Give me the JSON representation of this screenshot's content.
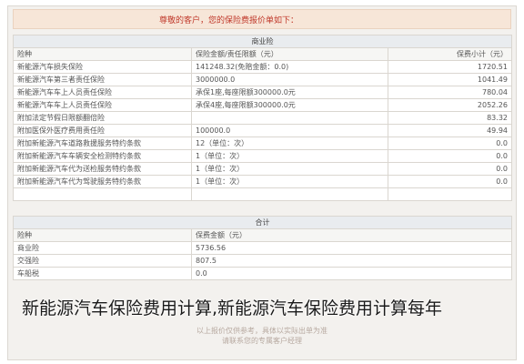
{
  "notice": "尊敬的客户，您的保险费报价单如下：",
  "commercial": {
    "title": "商业险",
    "headers": [
      "险种",
      "保险金额/责任限额（元）",
      "保费小计（元）"
    ],
    "rows": [
      [
        "新能源汽车损失保险",
        "141248.32(免赔金额：0.0)",
        "1720.51"
      ],
      [
        "新能源汽车第三者责任保险",
        "3000000.0",
        "1041.49"
      ],
      [
        "新能源汽车车上人员责任保险",
        "承保1座,每座限额300000.0元",
        "780.04"
      ],
      [
        "新能源汽车车上人员责任保险",
        "承保4座,每座限额300000.0元",
        "2052.26"
      ],
      [
        "附加法定节假日限额翻倍险",
        "",
        "83.32"
      ],
      [
        "附加医保外医疗费用责任险",
        "100000.0",
        "49.94"
      ],
      [
        "附加新能源汽车道路救援服务特约条款",
        "12（单位：次）",
        "0.0"
      ],
      [
        "附加新能源汽车车辆安全检测特约条款",
        "1（单位：次）",
        "0.0"
      ],
      [
        "附加新能源汽车代为送检服务特约条款",
        "1（单位：次）",
        "0.0"
      ],
      [
        "附加新能源汽车代为驾驶服务特约条款",
        "1（单位：次）",
        "0.0"
      ],
      [
        "",
        "",
        ""
      ]
    ]
  },
  "total": {
    "title": "合计",
    "headers": [
      "险种",
      "保费金额（元）"
    ],
    "rows": [
      [
        "商业险",
        "5736.56"
      ],
      [
        "交强险",
        "807.5"
      ],
      [
        "车船税",
        "0.0"
      ]
    ]
  },
  "caption": "新能源汽车保险费用计算,新能源汽车保险费用计算每年",
  "watermark": [
    "以上报价仅供参考，具体以实际出单为准",
    "请联系您的专属客户经理"
  ]
}
